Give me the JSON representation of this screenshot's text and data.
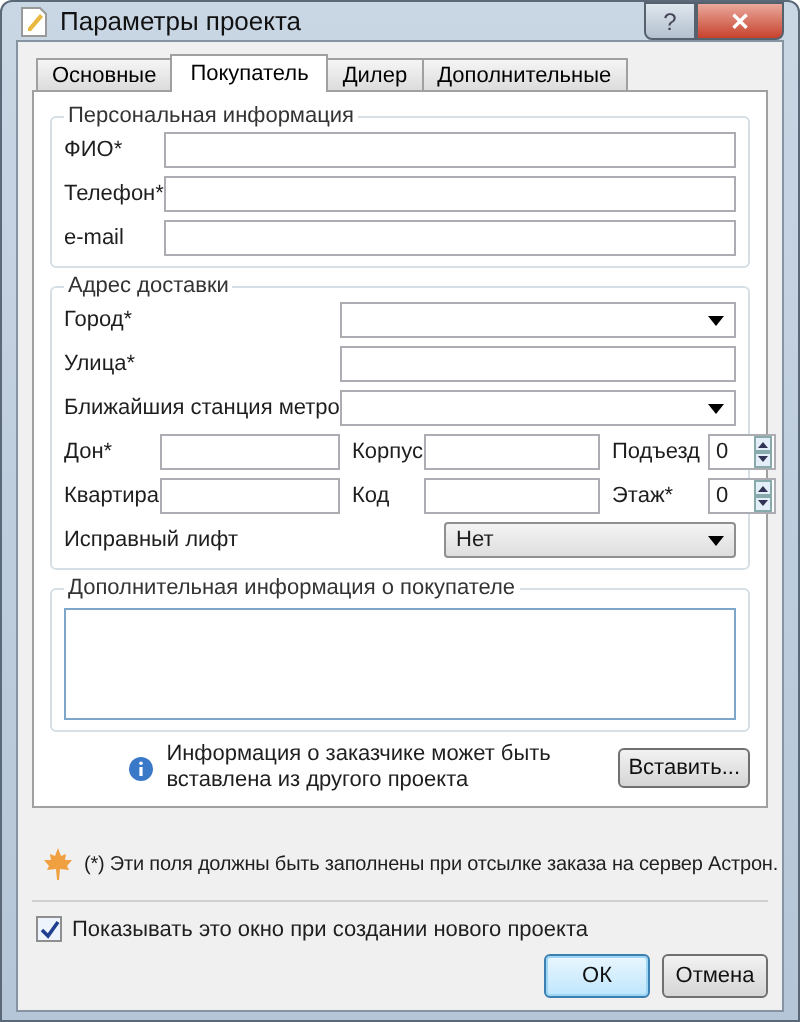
{
  "window": {
    "title": "Параметры проекта",
    "help": "?",
    "close": "✕"
  },
  "tabs": [
    {
      "label": "Основные",
      "selected": false
    },
    {
      "label": "Покупатель",
      "selected": true
    },
    {
      "label": "Дилер",
      "selected": false
    },
    {
      "label": "Дополнительные",
      "selected": false
    }
  ],
  "personal": {
    "title": "Персональная информация",
    "fields": [
      {
        "label": "ФИО*"
      },
      {
        "label": "Телефон*"
      },
      {
        "label": "e-mail"
      }
    ]
  },
  "address": {
    "title": "Адрес доставки",
    "rows": [
      {
        "kind": "wide",
        "cells": [
          {
            "label": "Город*",
            "kind": "combo"
          }
        ]
      },
      {
        "kind": "wide",
        "cells": [
          {
            "label": "Улица*",
            "kind": "text"
          }
        ]
      },
      {
        "kind": "wide",
        "cells": [
          {
            "label": "Ближайшия станция метро",
            "kind": "combo"
          }
        ]
      },
      {
        "kind": "triple",
        "cells": [
          {
            "label": "Дон*",
            "kind": "text"
          },
          {
            "label": "Корпус",
            "kind": "text"
          },
          {
            "label": "Подъезд",
            "kind": "spinner",
            "value": "0"
          }
        ]
      },
      {
        "kind": "triple",
        "cells": [
          {
            "label": "Квартира",
            "kind": "text"
          },
          {
            "label": "Код",
            "kind": "text"
          },
          {
            "label": "Этаж*",
            "kind": "spinner",
            "value": "0"
          }
        ]
      },
      {
        "kind": "half",
        "cells": [
          {
            "label": "Исправный лифт",
            "kind": "select",
            "value": "Нет"
          }
        ]
      }
    ]
  },
  "extra": {
    "title": "Дополнительная информация о покупателе"
  },
  "paste": {
    "text": "Информация о заказчике может быть вставлена из другого проекта",
    "button": "Вставить..."
  },
  "note": "(*) Эти поля должны быть заполнены при отсылке заказа на сервер Астрон.",
  "show_on_new": {
    "label": "Показывать это окно при создании нового проекта",
    "checked": true
  },
  "buttons": [
    {
      "label": "ОК",
      "default": true
    },
    {
      "label": "Отмена",
      "default": false
    }
  ]
}
